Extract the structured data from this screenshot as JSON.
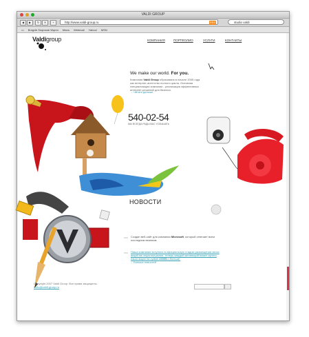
{
  "window": {
    "title": "VALDI GROUP"
  },
  "toolbar": {
    "url": "http://www.valdi-group.ru",
    "rss": "RSS",
    "search_value": "studio valdi"
  },
  "bookmarks": [
    "Bmgvlb Snqmosb Wqnm",
    "Mwvs",
    "Webmail",
    "Yahoo!",
    "MSN"
  ],
  "logo": {
    "name_bold": "Valdi",
    "name_light": "group"
  },
  "nav": [
    "КОМПАНИЯ",
    "ПОРТФОЛИО",
    "УСЛУГИ",
    "КОНТАКТЫ"
  ],
  "hero": {
    "motto_a": "We make our world. ",
    "motto_b": "For you.",
    "intro_a": "Компания ",
    "intro_brand": "Valdi Group",
    "intro_b": " образована в начале 2005 года как интернет-агентство полного цикла. Основная специализация компании - реализация эффективных интернет-решений для бизнеса.",
    "more": "Читать дальше"
  },
  "phone": {
    "number": "540-02-54",
    "caption": "МЫ ВСЕГДА РАДЫ ВАС УСЛЫШАТЬ"
  },
  "news": {
    "heading": "НОВОСТИ",
    "items": [
      {
        "a": "Создан веб-сайт для компании ",
        "brand": "Microsoft",
        "b": ", который отвечает всем последним веяниям."
      },
      {
        "a": "Наша компания вступила в официальную стадию размещения своих акций на открытом рынке, теперь каждый желающий может купить наши акции на сумме ",
        "brand": "2400$",
        "b": " и больше."
      }
    ],
    "all": "Больше новостей"
  },
  "footer": {
    "copyright": "Copyright 2007 Valdi Group. Все права защищены.",
    "email": "hello@valdi-group.ru"
  },
  "colors": {
    "accent": "#31a0b4",
    "phone_red": "#e8202a",
    "brand_red": "#d8334a"
  }
}
